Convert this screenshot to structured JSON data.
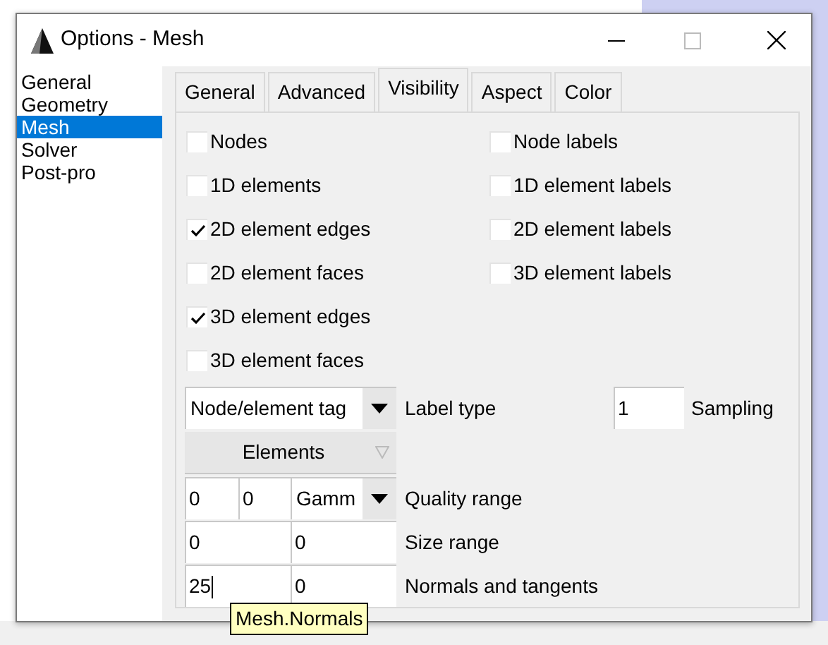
{
  "window": {
    "title": "Options - Mesh"
  },
  "sidebar": {
    "items": [
      {
        "label": "General",
        "selected": false
      },
      {
        "label": "Geometry",
        "selected": false
      },
      {
        "label": "Mesh",
        "selected": true
      },
      {
        "label": "Solver",
        "selected": false
      },
      {
        "label": "Post-pro",
        "selected": false
      }
    ]
  },
  "tabs": [
    {
      "label": "General",
      "selected": false
    },
    {
      "label": "Advanced",
      "selected": false
    },
    {
      "label": "Visibility",
      "selected": true
    },
    {
      "label": "Aspect",
      "selected": false
    },
    {
      "label": "Color",
      "selected": false
    }
  ],
  "checkboxes_left": [
    {
      "label": "Nodes",
      "checked": false
    },
    {
      "label": "1D elements",
      "checked": false
    },
    {
      "label": "2D element edges",
      "checked": true
    },
    {
      "label": "2D element faces",
      "checked": false
    },
    {
      "label": "3D element edges",
      "checked": true
    },
    {
      "label": "3D element faces",
      "checked": false
    }
  ],
  "checkboxes_right": [
    {
      "label": "Node labels",
      "checked": false
    },
    {
      "label": "1D element labels",
      "checked": false
    },
    {
      "label": "2D element labels",
      "checked": false
    },
    {
      "label": "3D element labels",
      "checked": false
    }
  ],
  "label_type": {
    "value": "Node/element tag",
    "label": "Label type"
  },
  "sampling": {
    "value": "1",
    "label": "Sampling"
  },
  "elements_button": {
    "label": "Elements"
  },
  "quality_range": {
    "min": "0",
    "max": "0",
    "measure": "Gamm",
    "label": "Quality range"
  },
  "size_range": {
    "min": "0",
    "max": "0",
    "label": "Size range"
  },
  "normals": {
    "normals": "25",
    "tangents": "0",
    "label": "Normals and tangents"
  },
  "tooltip": {
    "text": "Mesh.Normals"
  }
}
